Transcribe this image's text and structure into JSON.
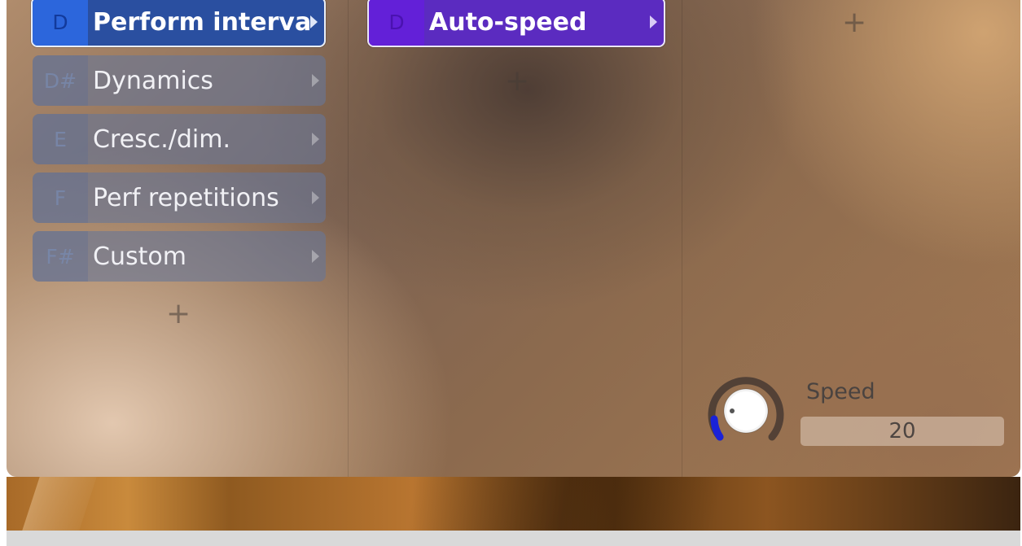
{
  "column1": {
    "slots": [
      {
        "key": "D",
        "label": "Perform interval",
        "state": "active"
      },
      {
        "key": "D#",
        "label": "Dynamics",
        "state": "inactive"
      },
      {
        "key": "E",
        "label": "Cresc./dim.",
        "state": "inactive"
      },
      {
        "key": "F",
        "label": "Perf repetitions",
        "state": "inactive"
      },
      {
        "key": "F#",
        "label": "Custom",
        "state": "inactive"
      }
    ],
    "add_symbol": "+"
  },
  "column2": {
    "slots": [
      {
        "key": "D",
        "label": "Auto-speed",
        "state": "active"
      }
    ],
    "add_symbol": "+"
  },
  "column3": {
    "add_symbol": "+"
  },
  "speed": {
    "label": "Speed",
    "value": "20"
  },
  "colors": {
    "active_blue": "#2a4fa0",
    "active_purple": "#5b2bc0",
    "knob_indicator": "#1a22d8",
    "inactive_slot": "#687696"
  }
}
